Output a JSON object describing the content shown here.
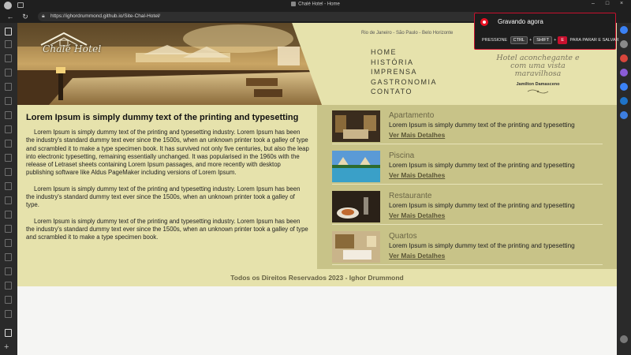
{
  "browser": {
    "window_title": "Chalé Hotel - Home",
    "url": "https://ighordrummond.github.io/Site-Chal-Hotel/"
  },
  "recording": {
    "title": "Gravando agora",
    "press_label": "PRESSIONE",
    "keys": [
      "CTRL",
      "SHIFT",
      "E"
    ],
    "plus": "+",
    "action": "PARA PARAR E SALVAR",
    "accent": "#e81123"
  },
  "site": {
    "logo": "Chalé Hotel",
    "cities": "Rio de Janeiro - São Paulo - Belo Horizonte",
    "nav": [
      "HOME",
      "HISTÓRIA",
      "IMPRENSA",
      "GASTRONOMIA",
      "CONTATO"
    ],
    "slogan": "Hotel aconchegante e com uma vista maravilhosa",
    "slogan_author": "Jamilton Damasceno",
    "heading": "Lorem Ipsum is simply dummy text of the printing and typesetting",
    "paragraphs": [
      "Lorem Ipsum is simply dummy text of the printing and typesetting industry. Lorem Ipsum has been the industry's standard dummy text ever since the 1500s, when an unknown printer took a galley of type and scrambled it to make a type specimen book. It has survived not only five centuries, but also the leap into electronic typesetting, remaining essentially unchanged. It was popularised in the 1960s with the release of Letraset sheets containing Lorem Ipsum passages, and more recently with desktop publishing software like Aldus PageMaker including versions of Lorem Ipsum.",
      "Lorem Ipsum is simply dummy text of the printing and typesetting industry. Lorem Ipsum has been the industry's standard dummy text ever since the 1500s, when an unknown printer took a galley of type.",
      "Lorem Ipsum is simply dummy text of the printing and typesetting industry. Lorem Ipsum has been the industry's standard dummy text ever since the 1500s, when an unknown printer took a galley of type and scrambled it to make a type specimen book."
    ],
    "services": [
      {
        "title": "Apartamento",
        "text": "Lorem Ipsum is simply dummy text of the printing and typesetting",
        "link": "Ver Mais Detalhes"
      },
      {
        "title": "Piscina",
        "text": "Lorem Ipsum is simply dummy text of the printing and typesetting",
        "link": "Ver Mais Detalhes"
      },
      {
        "title": "Restaurante",
        "text": "Lorem Ipsum is simply dummy text of the printing and typesetting",
        "link": "Ver Mais Detalhes"
      },
      {
        "title": "Quartos",
        "text": "Lorem Ipsum is simply dummy text of the printing and typesetting",
        "link": "Ver Mais Detalhes"
      }
    ],
    "footer": "Todos os Direitos Reservados 2023 - Ighor Drummond",
    "colors": {
      "cream": "#e6e2ac",
      "olive": "#c8c388",
      "text_dark": "#222222"
    }
  }
}
